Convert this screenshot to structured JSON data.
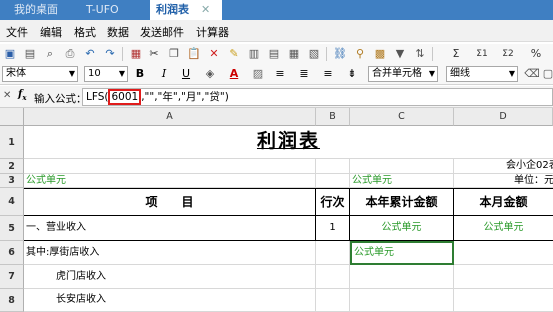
{
  "tabs": [
    {
      "label": "我的桌面",
      "active": false
    },
    {
      "label": "T-UFO",
      "active": false
    },
    {
      "label": "利润表",
      "active": true
    }
  ],
  "menu": [
    "文件",
    "编辑",
    "格式",
    "数据",
    "发送邮件",
    "计算器"
  ],
  "toolbar": {
    "font_name": "宋体",
    "font_size": "10",
    "bold": "B",
    "italic": "I",
    "underline": "U",
    "merge_cells": "合并单元格",
    "border_style": "细线"
  },
  "formula_bar": {
    "label": "输入公式：",
    "prefix": "LFS(",
    "highlight": "6001",
    "suffix": ",\"\",\"年\",\"月\",\"贷\")"
  },
  "columns": [
    "A",
    "B",
    "C",
    "D"
  ],
  "rows": [
    "1",
    "2",
    "3",
    "4",
    "5",
    "6",
    "7",
    "8"
  ],
  "sheet": {
    "title": "利润表",
    "company": "会小企02表",
    "unit": "单位：元",
    "formula_cell_a3": "公式单元",
    "formula_cell_c3": "公式单元",
    "header_item": "项　　目",
    "header_line": "行次",
    "header_year": "本年累计金额",
    "header_month": "本月金额",
    "row5_item": "一、营业收入",
    "row5_line": "1",
    "row5_year": "公式单元",
    "row5_month": "公式单元",
    "row6_item": "其中:厚街店收入",
    "row6_year": "公式单元",
    "row7_item": "虎门店收入",
    "row8_item": "长安店收入"
  },
  "colors": {
    "tab_bar": "#3f7fc2",
    "formula_green": "#2a9a2a",
    "highlight_red": "#e01b1b"
  }
}
